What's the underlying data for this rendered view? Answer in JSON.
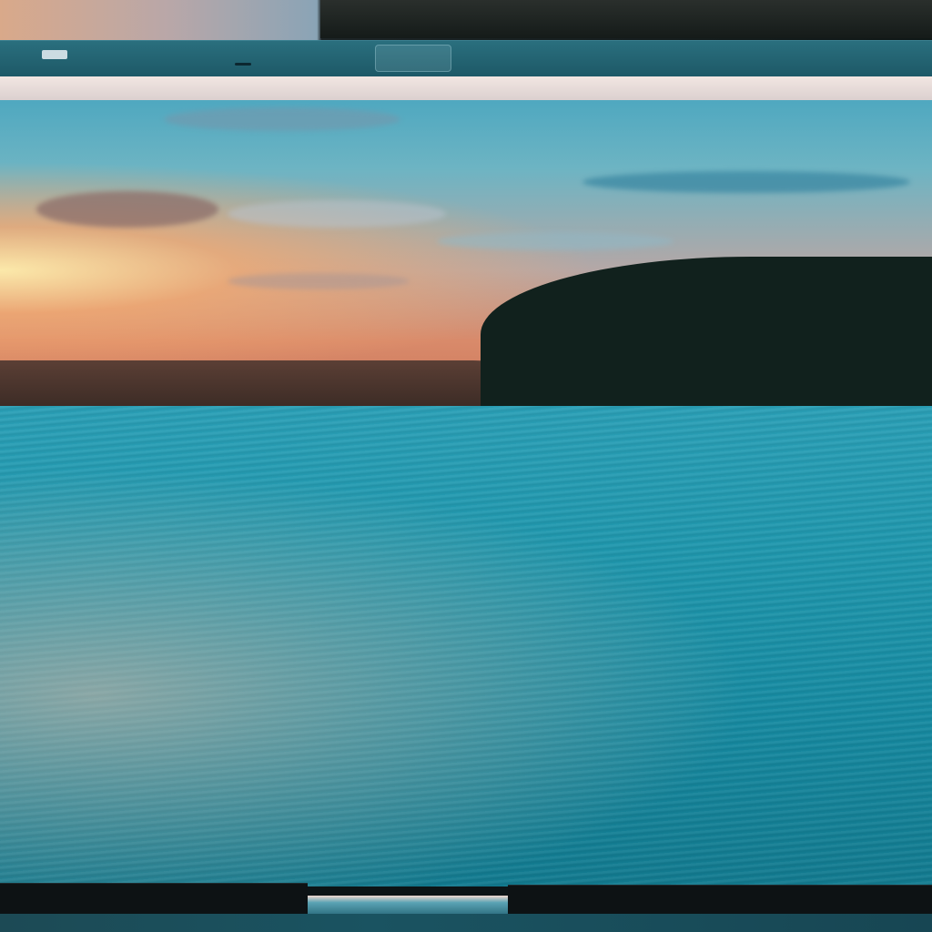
{
  "window": {
    "title": ""
  },
  "icons": {
    "toolbar_left": "tag-icon",
    "toolbar_center": "image-icon",
    "toolbar_small": "minus-icon"
  },
  "colors": {
    "toolbar_bg": "#1d5866",
    "separator_bg": "#f2e6e2",
    "water": "#168aa1",
    "sky_warm": "#d98a6a",
    "sky_cool": "#4fa8c0",
    "forest": "#11211d",
    "frame_dark": "#0c1416"
  }
}
